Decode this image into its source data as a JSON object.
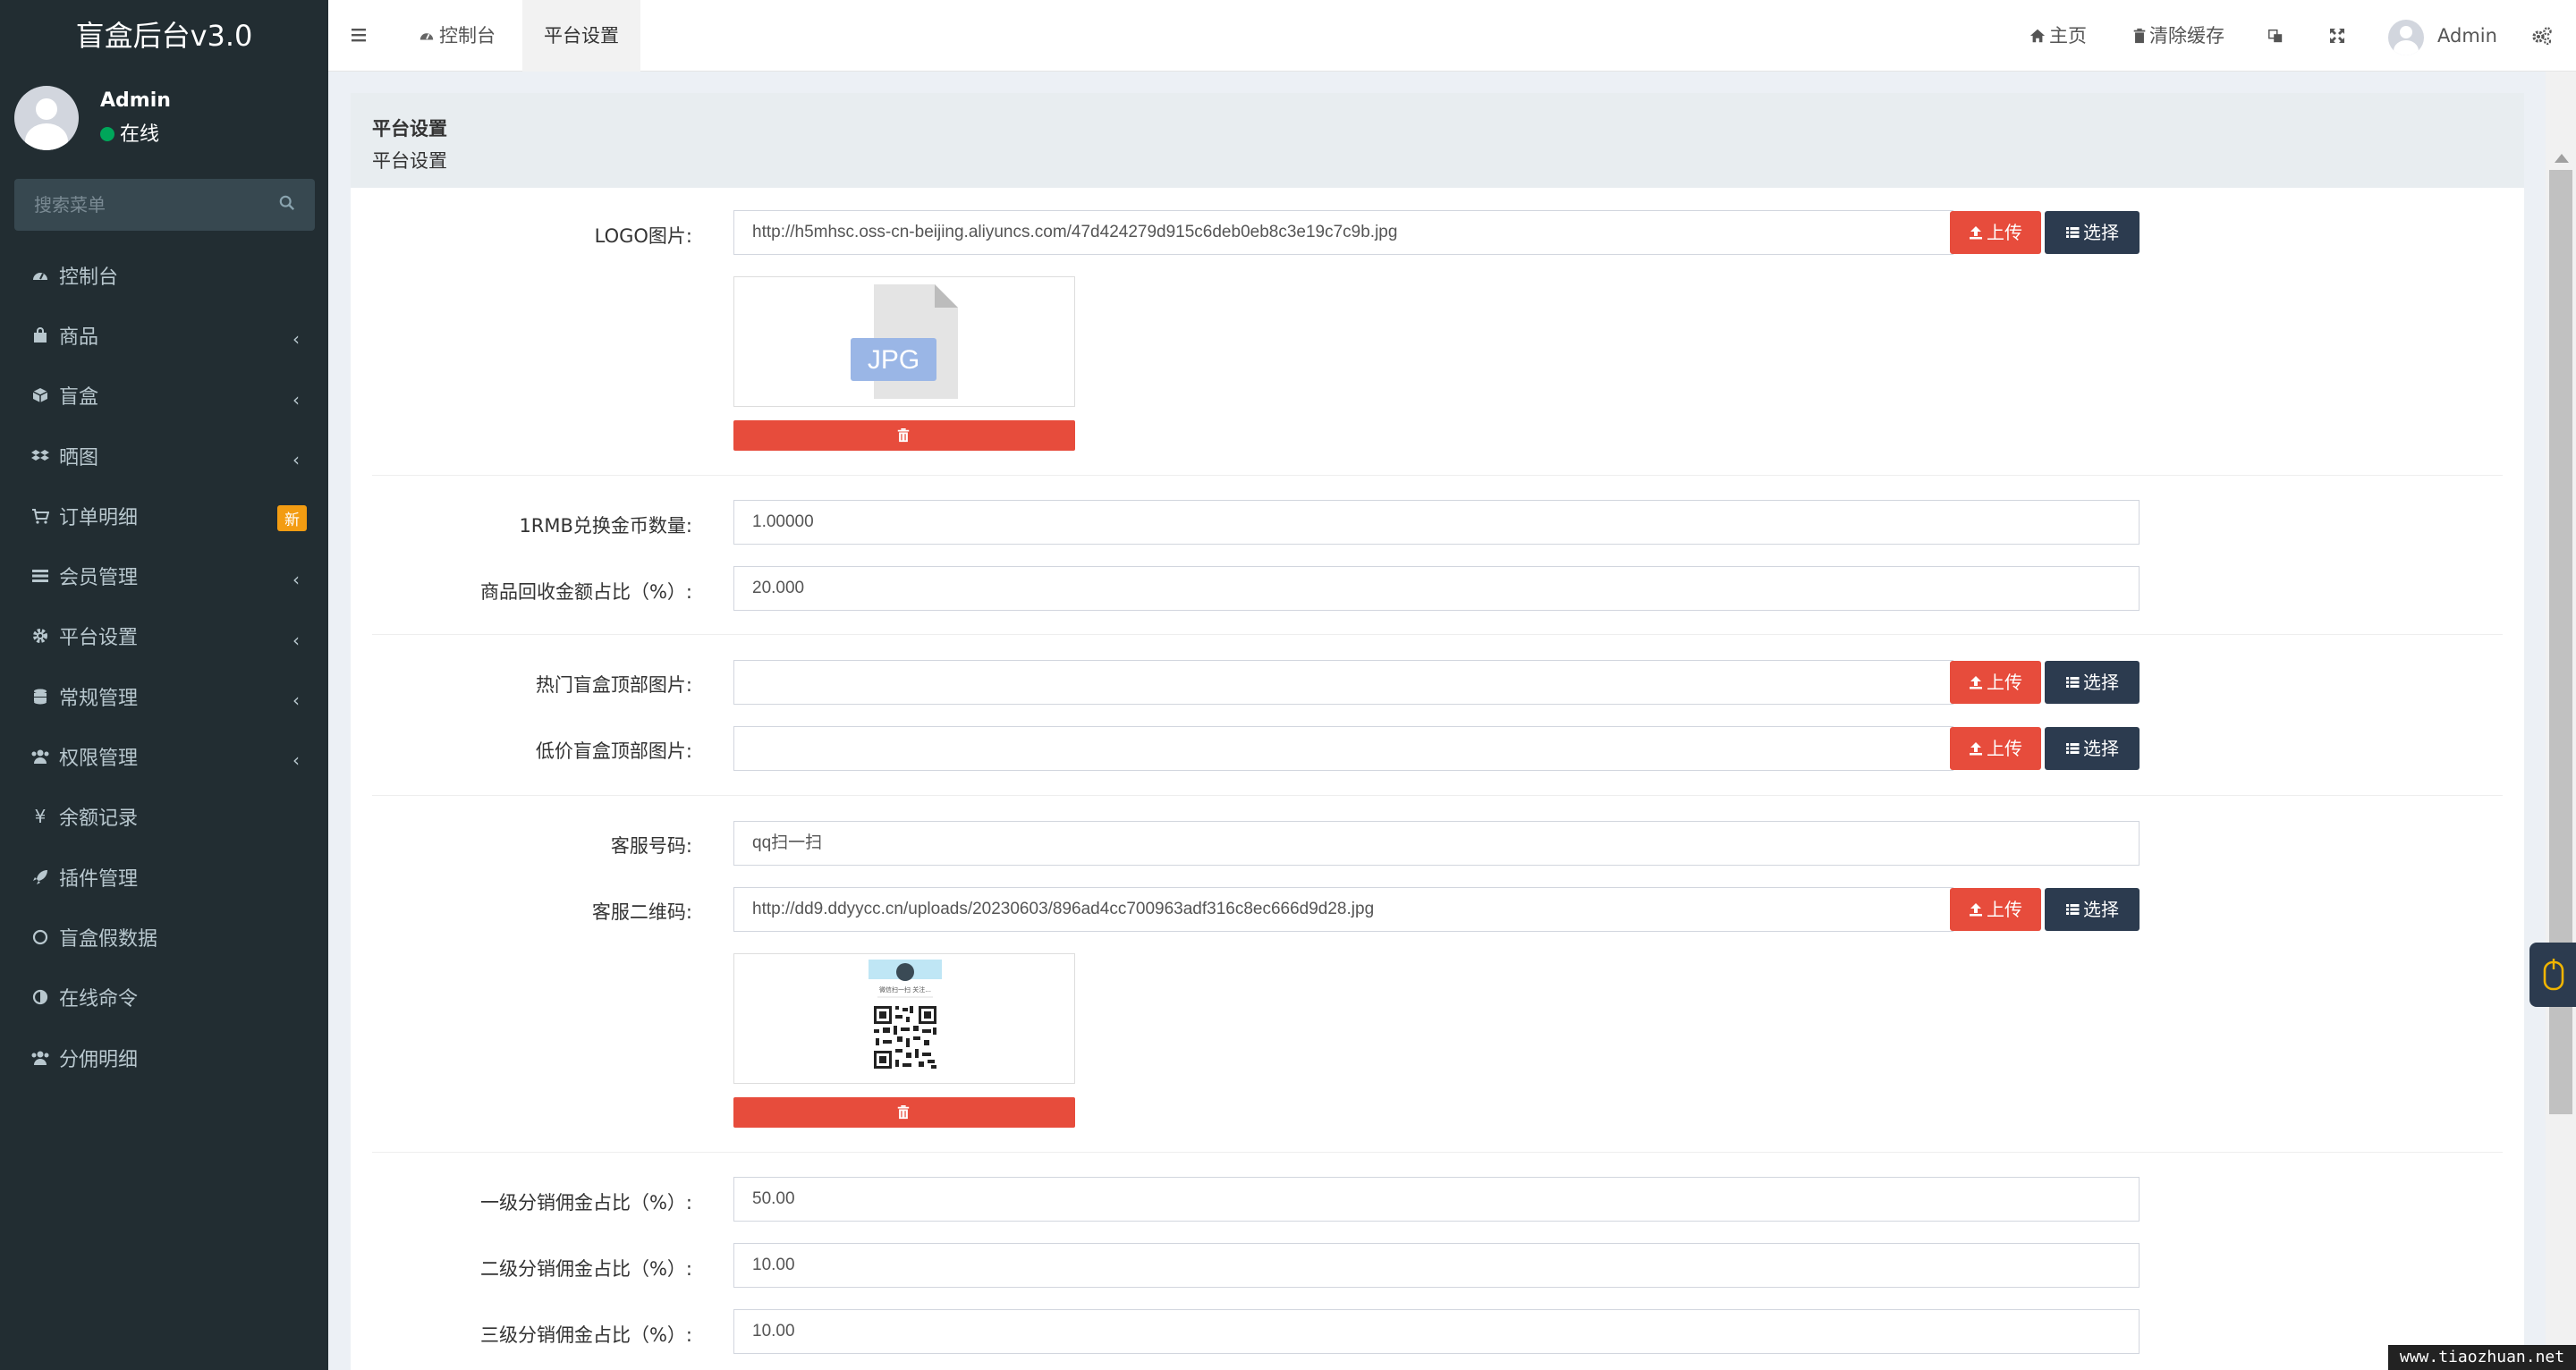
{
  "app": {
    "title": "盲盒后台v3.0"
  },
  "user": {
    "name": "Admin",
    "status": "在线"
  },
  "search": {
    "placeholder": "搜索菜单"
  },
  "menu": [
    {
      "label": "控制台",
      "icon": "dashboard-icon"
    },
    {
      "label": "商品",
      "icon": "shopping-bag-icon",
      "has_sub": true
    },
    {
      "label": "盲盒",
      "icon": "cube-icon",
      "has_sub": true
    },
    {
      "label": "晒图",
      "icon": "dropbox-icon",
      "has_sub": true
    },
    {
      "label": "订单明细",
      "icon": "cart-icon",
      "badge": "新"
    },
    {
      "label": "会员管理",
      "icon": "list-icon",
      "has_sub": true
    },
    {
      "label": "平台设置",
      "icon": "gear-icon",
      "has_sub": true
    },
    {
      "label": "常规管理",
      "icon": "database-icon",
      "has_sub": true
    },
    {
      "label": "权限管理",
      "icon": "users-icon",
      "has_sub": true
    },
    {
      "label": "余额记录",
      "icon": "yen-icon"
    },
    {
      "label": "插件管理",
      "icon": "rocket-icon"
    },
    {
      "label": "盲盒假数据",
      "icon": "circle-icon"
    },
    {
      "label": "在线命令",
      "icon": "adjust-icon"
    },
    {
      "label": "分佣明细",
      "icon": "users-icon"
    }
  ],
  "header": {
    "tabs": [
      {
        "label": "控制台",
        "icon": "dashboard-icon"
      },
      {
        "label": "平台设置"
      }
    ],
    "home_label": "主页",
    "clear_cache_label": "清除缓存",
    "user_label": "Admin"
  },
  "panel": {
    "title": "平台设置",
    "subtitle": "平台设置"
  },
  "buttons": {
    "upload": "上传",
    "select": "选择"
  },
  "form": {
    "logo": {
      "label": "LOGO图片:",
      "value": "http://h5mhsc.oss-cn-beijing.aliyuncs.com/47d424279d915c6deb0eb8c3e19c7c9b.jpg",
      "preview_text": "JPG"
    },
    "rmb_rate": {
      "label": "1RMB兑换金币数量:",
      "value": "1.00000"
    },
    "recycle_ratio": {
      "label": "商品回收金额占比（%）:",
      "value": "20.000"
    },
    "hot_box_img": {
      "label": "热门盲盒顶部图片:",
      "value": ""
    },
    "cheap_box_img": {
      "label": "低价盲盒顶部图片:",
      "value": ""
    },
    "service_number": {
      "label": "客服号码:",
      "value": "qq扫一扫"
    },
    "service_qr": {
      "label": "客服二维码:",
      "value": "http://dd9.ddyycc.cn/uploads/20230603/896ad4cc700963adf316c8ec666d9d28.jpg",
      "qr_caption": "微信扫一扫 关注..."
    },
    "level1": {
      "label": "一级分销佣金占比（%）:",
      "value": "50.00"
    },
    "level2": {
      "label": "二级分销佣金占比（%）:",
      "value": "10.00"
    },
    "level3": {
      "label": "三级分销佣金占比（%）:",
      "value": "10.00"
    }
  },
  "watermark": "www.tiaozhuan.net",
  "colors": {
    "sidebar": "#222d32",
    "danger": "#e74c3c",
    "dark_button": "#2c3b4f",
    "badge": "#f39c12",
    "online": "#00a65a"
  }
}
